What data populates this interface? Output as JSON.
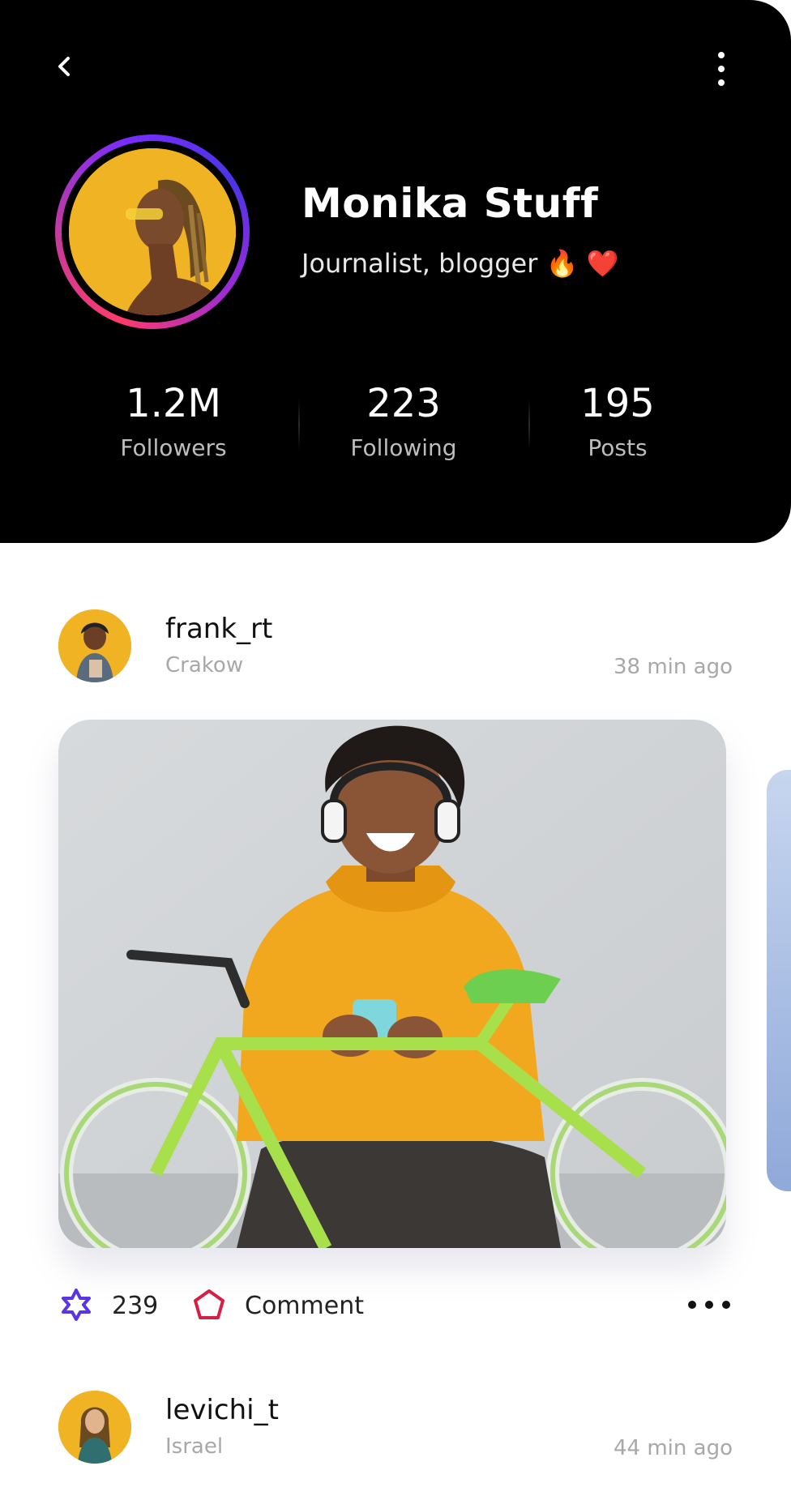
{
  "profile": {
    "name": "Monika Stuff",
    "bio": "Journalist, blogger 🔥 ❤️"
  },
  "stats": [
    {
      "value": "1.2M",
      "label": "Followers"
    },
    {
      "value": "223",
      "label": "Following"
    },
    {
      "value": "195",
      "label": "Posts"
    }
  ],
  "posts": [
    {
      "user": "frank_rt",
      "location": "Crakow",
      "time": "38 min ago",
      "likes": "239",
      "comment_label": "Comment"
    },
    {
      "user": "levichi_t",
      "location": "Israel",
      "time": "44 min ago"
    }
  ],
  "icons": {
    "back": "chevron-left-icon",
    "menu": "more-vertical-icon",
    "like": "star-icon",
    "comment": "pentagon-icon",
    "options": "more-horizontal-icon"
  },
  "colors": {
    "header_bg": "#000000",
    "like_icon": "#5b34e8",
    "comment_icon": "#d61f45",
    "avatar_bg": "#f0b323"
  }
}
